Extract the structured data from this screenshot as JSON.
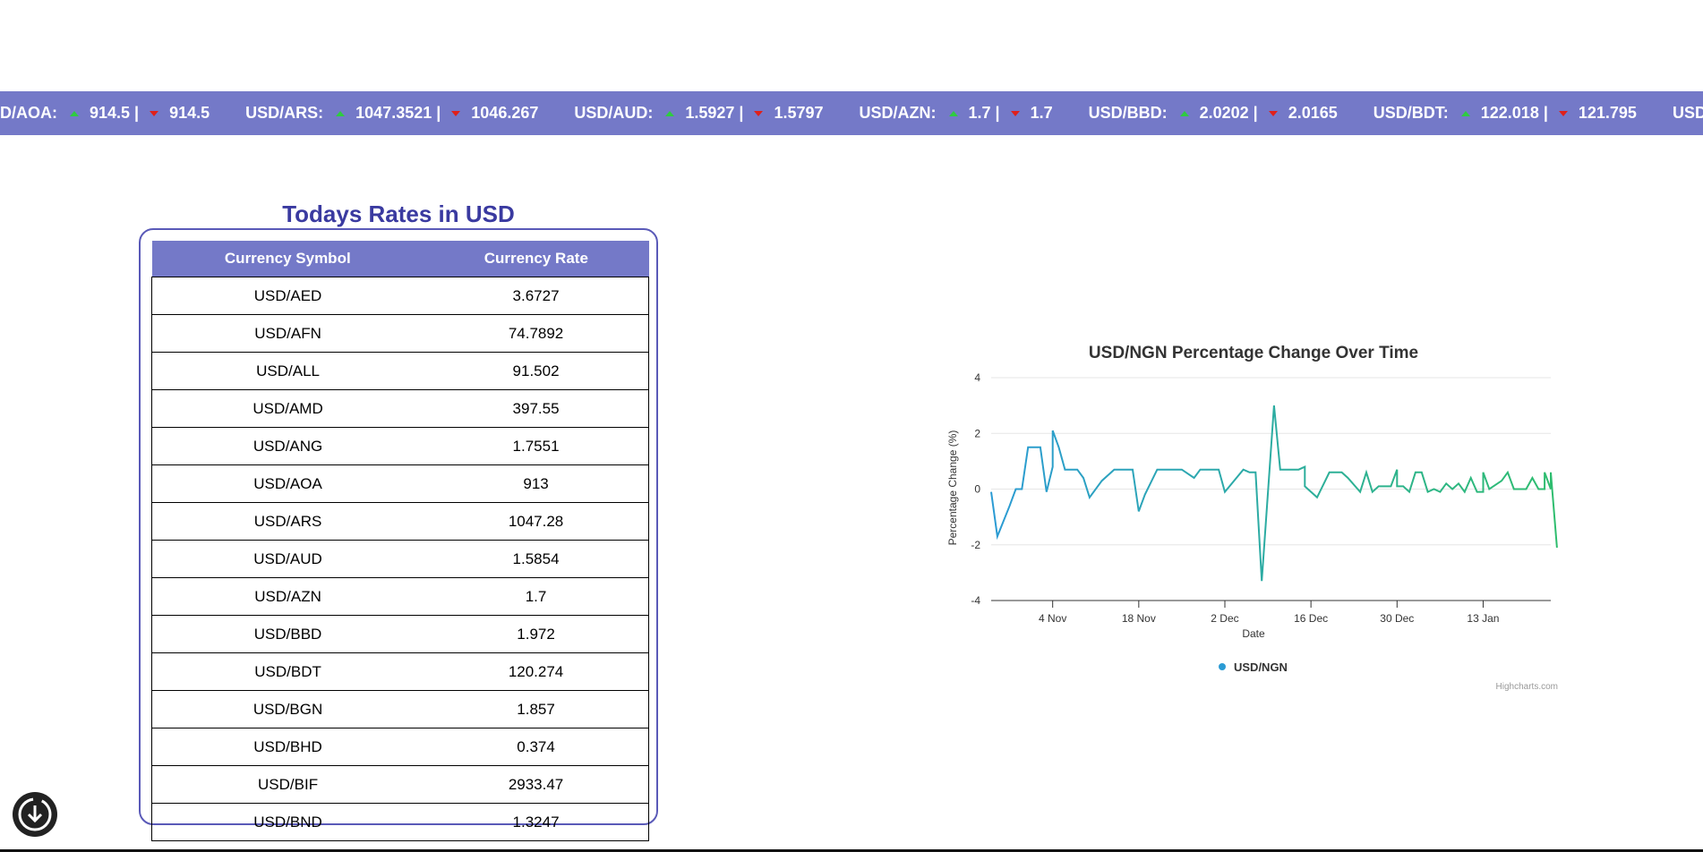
{
  "ticker": [
    {
      "symbol": "SD/AOA:",
      "high": "914.5 |",
      "low": "914.5"
    },
    {
      "symbol": "USD/ARS:",
      "high": "1047.3521 |",
      "low": "1046.267"
    },
    {
      "symbol": "USD/AUD:",
      "high": "1.5927 |",
      "low": "1.5797"
    },
    {
      "symbol": "USD/AZN:",
      "high": "1.7 |",
      "low": "1.7"
    },
    {
      "symbol": "USD/BBD:",
      "high": "2.0202 |",
      "low": "2.0165"
    },
    {
      "symbol": "USD/BDT:",
      "high": "122.018 |",
      "low": "121.795"
    },
    {
      "symbol": "USD/BGN:",
      "high": "",
      "low": ""
    }
  ],
  "rates": {
    "title": "Todays Rates in USD",
    "headers": {
      "symbol": "Currency Symbol",
      "rate": "Currency Rate"
    },
    "rows": [
      {
        "symbol": "USD/AED",
        "rate": "3.6727"
      },
      {
        "symbol": "USD/AFN",
        "rate": "74.7892"
      },
      {
        "symbol": "USD/ALL",
        "rate": "91.502"
      },
      {
        "symbol": "USD/AMD",
        "rate": "397.55"
      },
      {
        "symbol": "USD/ANG",
        "rate": "1.7551"
      },
      {
        "symbol": "USD/AOA",
        "rate": "913"
      },
      {
        "symbol": "USD/ARS",
        "rate": "1047.28"
      },
      {
        "symbol": "USD/AUD",
        "rate": "1.5854"
      },
      {
        "symbol": "USD/AZN",
        "rate": "1.7"
      },
      {
        "symbol": "USD/BBD",
        "rate": "1.972"
      },
      {
        "symbol": "USD/BDT",
        "rate": "120.274"
      },
      {
        "symbol": "USD/BGN",
        "rate": "1.857"
      },
      {
        "symbol": "USD/BHD",
        "rate": "0.374"
      },
      {
        "symbol": "USD/BIF",
        "rate": "2933.47"
      },
      {
        "symbol": "USD/BND",
        "rate": "1.3247"
      }
    ]
  },
  "chart_data": {
    "type": "line",
    "title": "USD/NGN Percentage Change Over Time",
    "xlabel": "Date",
    "ylabel": "Percentage Change (%)",
    "ylim": [
      -4,
      4
    ],
    "yticks": [
      4,
      2,
      0,
      -2,
      -4
    ],
    "xticks": [
      "4 Nov",
      "18 Nov",
      "2 Dec",
      "16 Dec",
      "30 Dec",
      "13 Jan"
    ],
    "xrange": [
      "2024-10-25",
      "2025-01-24"
    ],
    "grid": true,
    "legend": "bottom-center",
    "series": [
      {
        "name": "USD/NGN",
        "color_start": "#2b9bd4",
        "color_end": "#2ebd6e",
        "points": [
          [
            "2024-10-25",
            -0.1
          ],
          [
            "2024-10-26",
            -1.7
          ],
          [
            "2024-10-28",
            -0.6
          ],
          [
            "2024-10-29",
            0
          ],
          [
            "2024-10-30",
            0
          ],
          [
            "2024-10-31",
            1.5
          ],
          [
            "2024-11-01",
            1.5
          ],
          [
            "2024-11-02",
            1.5
          ],
          [
            "2024-11-03",
            -0.1
          ],
          [
            "2024-11-04",
            0.8
          ],
          [
            "2024-11-04",
            2.1
          ],
          [
            "2024-11-05",
            1.5
          ],
          [
            "2024-11-06",
            0.7
          ],
          [
            "2024-11-07",
            0.7
          ],
          [
            "2024-11-08",
            0.7
          ],
          [
            "2024-11-09",
            0.4
          ],
          [
            "2024-11-10",
            -0.3
          ],
          [
            "2024-11-12",
            0.3
          ],
          [
            "2024-11-14",
            0.7
          ],
          [
            "2024-11-16",
            0.7
          ],
          [
            "2024-11-17",
            0.7
          ],
          [
            "2024-11-18",
            -0.8
          ],
          [
            "2024-11-19",
            -0.2
          ],
          [
            "2024-11-21",
            0.7
          ],
          [
            "2024-11-23",
            0.7
          ],
          [
            "2024-11-25",
            0.7
          ],
          [
            "2024-11-27",
            0.4
          ],
          [
            "2024-11-28",
            0.7
          ],
          [
            "2024-11-30",
            0.7
          ],
          [
            "2024-12-01",
            0.7
          ],
          [
            "2024-12-02",
            -0.1
          ],
          [
            "2024-12-05",
            0.7
          ],
          [
            "2024-12-06",
            0.6
          ],
          [
            "2024-12-07",
            0.6
          ],
          [
            "2024-12-08",
            -3.3
          ],
          [
            "2024-12-10",
            3
          ],
          [
            "2024-12-11",
            0.7
          ],
          [
            "2024-12-12",
            0.7
          ],
          [
            "2024-12-13",
            0.7
          ],
          [
            "2024-12-14",
            0.7
          ],
          [
            "2024-12-15",
            0.8
          ],
          [
            "2024-12-15",
            0.1
          ],
          [
            "2024-12-17",
            -0.3
          ],
          [
            "2024-12-19",
            0.6
          ],
          [
            "2024-12-21",
            0.6
          ],
          [
            "2024-12-22",
            0.4
          ],
          [
            "2024-12-24",
            -0.1
          ],
          [
            "2024-12-25",
            0.6
          ],
          [
            "2024-12-26",
            -0.1
          ],
          [
            "2024-12-27",
            0.1
          ],
          [
            "2024-12-28",
            0.1
          ],
          [
            "2024-12-29",
            0.1
          ],
          [
            "2024-12-30",
            0.7
          ],
          [
            "2024-12-30",
            0.1
          ],
          [
            "2024-12-31",
            0.1
          ],
          [
            "2025-01-01",
            -0.1
          ],
          [
            "2025-01-02",
            0.6
          ],
          [
            "2025-01-03",
            0.6
          ],
          [
            "2025-01-04",
            -0.1
          ],
          [
            "2025-01-05",
            0
          ],
          [
            "2025-01-06",
            -0.1
          ],
          [
            "2025-01-07",
            0.2
          ],
          [
            "2025-01-08",
            0
          ],
          [
            "2025-01-09",
            0.2
          ],
          [
            "2025-01-10",
            -0.1
          ],
          [
            "2025-01-11",
            0.4
          ],
          [
            "2025-01-12",
            -0.1
          ],
          [
            "2025-01-13",
            -0.1
          ],
          [
            "2025-01-13",
            0.6
          ],
          [
            "2025-01-14",
            0
          ],
          [
            "2025-01-16",
            0.3
          ],
          [
            "2025-01-17",
            0.6
          ],
          [
            "2025-01-18",
            0
          ],
          [
            "2025-01-20",
            0
          ],
          [
            "2025-01-21",
            0.4
          ],
          [
            "2025-01-22",
            0
          ],
          [
            "2025-01-23",
            0
          ],
          [
            "2025-01-23",
            0.6
          ],
          [
            "2025-01-24",
            0
          ],
          [
            "2025-01-24",
            0.6
          ],
          [
            "2025-01-25",
            -2.1
          ]
        ]
      }
    ],
    "credit": "Highcharts.com"
  },
  "icons": {
    "download": "download-icon"
  }
}
